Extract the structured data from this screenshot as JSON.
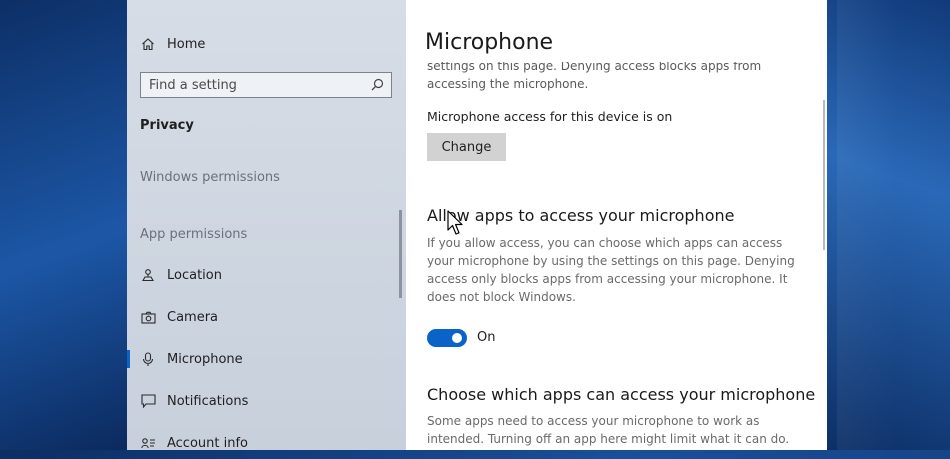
{
  "sidebar": {
    "home_label": "Home",
    "search_placeholder": "Find a setting",
    "section_title": "Privacy",
    "group_windows_permissions": "Windows permissions",
    "group_app_permissions": "App permissions",
    "items": [
      {
        "label": "Location",
        "icon": "location-icon"
      },
      {
        "label": "Camera",
        "icon": "camera-icon"
      },
      {
        "label": "Microphone",
        "icon": "microphone-icon",
        "active": true
      },
      {
        "label": "Notifications",
        "icon": "notifications-icon"
      },
      {
        "label": "Account info",
        "icon": "account-info-icon"
      }
    ]
  },
  "main": {
    "title": "Microphone",
    "intro_cut_text": "settings on this page. Denying access blocks apps from accessing the microphone.",
    "device_access_status": "Microphone access for this device is on",
    "change_button_label": "Change",
    "allow_heading": "Allow apps to access your microphone",
    "allow_description": "If you allow access, you can choose which apps can access your microphone by using the settings on this page. Denying access only blocks apps from accessing your microphone. It does not block Windows.",
    "toggle_state_label": "On",
    "toggle_on": true,
    "choose_heading": "Choose which apps can access your microphone",
    "choose_description": "Some apps need to access your microphone to work as intended. Turning off an app here might limit what it can do."
  },
  "colors": {
    "accent": "#0a63c9",
    "sidebar_bg": "#d7dde6",
    "content_bg": "#ffffff",
    "button_bg": "#d2d2d2"
  }
}
